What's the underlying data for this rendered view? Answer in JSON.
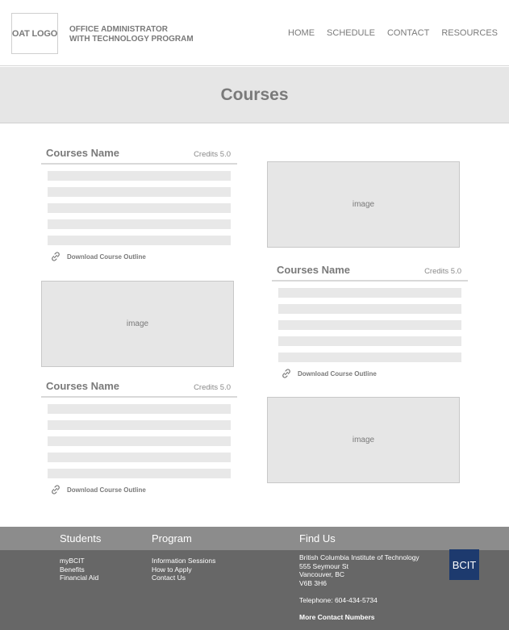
{
  "header": {
    "logo_text": "OAT LOGO",
    "program_line1": "OFFICE ADMINISTRATOR",
    "program_line2": "WITH TECHNOLOGY PROGRAM",
    "nav": [
      "HOME",
      "SCHEDULE",
      "CONTACT",
      "RESOURCES"
    ]
  },
  "hero": {
    "title": "Courses"
  },
  "courses": [
    {
      "name": "Courses Name",
      "credits": "Credits 5.0",
      "download": "Download Course Outline"
    },
    {
      "name": "Courses Name",
      "credits": "Credits 5.0",
      "download": "Download Course Outline"
    },
    {
      "name": "Courses Name",
      "credits": "Credits 5.0",
      "download": "Download Course Outline"
    }
  ],
  "image_label": "image",
  "footer": {
    "students": {
      "heading": "Students",
      "links": [
        "myBCIT",
        "Benefits",
        "Financial Aid"
      ]
    },
    "program": {
      "heading": "Program",
      "links": [
        "Information Sessions",
        "How to Apply",
        "Contact Us"
      ]
    },
    "find_us": {
      "heading": "Find Us",
      "address": [
        "British Columbia Institute of Technology",
        "555 Seymour St",
        "Vancouver, BC",
        "V6B 3H6"
      ],
      "telephone": "Telephone: 604-434-5734",
      "more": "More Contact Numbers"
    },
    "bcit_logo": "BCIT"
  },
  "colors": {
    "placeholder_fill": "#e8e8e8",
    "footer_top": "#8c8c8c",
    "footer_bottom": "#676767",
    "bcit_blue": "#1d3a6e"
  }
}
